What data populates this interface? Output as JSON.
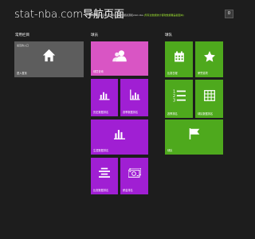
{
  "header": {
    "title": "stat-nba.com导航页面",
    "tagline": "领略赛由北京新以方领以提供数据资源和stat-nba",
    "tagline_highlight": "(所有这数据统计都较数据覆盖截图本)",
    "corner_button": "0"
  },
  "sections": {
    "common": {
      "title": "常用栏目"
    },
    "players": {
      "title": "球员"
    },
    "teams": {
      "title": "球队"
    }
  },
  "tiles": {
    "personal_home": {
      "label": "进入首页",
      "sublabel": "最近的入口"
    },
    "player_query": {
      "label": "球员查询"
    },
    "history_stats": {
      "label": "历史数据排名"
    },
    "season_stats": {
      "label": "赛季数据排名"
    },
    "career_stats": {
      "label": "生涯数据排名"
    },
    "game_ranking": {
      "label": "比赛数据排名"
    },
    "salary_ranking": {
      "label": "薪金排名"
    },
    "schedule": {
      "label": "比赛日程"
    },
    "award": {
      "label": "荣誉奖项"
    },
    "standings": {
      "label": "赛季排名"
    },
    "team_stats": {
      "label": "球队数据排名"
    },
    "franchise": {
      "label": "球队"
    }
  },
  "colors": {
    "background": "#1d1d1d",
    "gray_tile": "#5d5d5d",
    "pink_tile": "#d955c4",
    "purple_tile": "#a01fd3",
    "green_tile": "#4ea91d"
  }
}
